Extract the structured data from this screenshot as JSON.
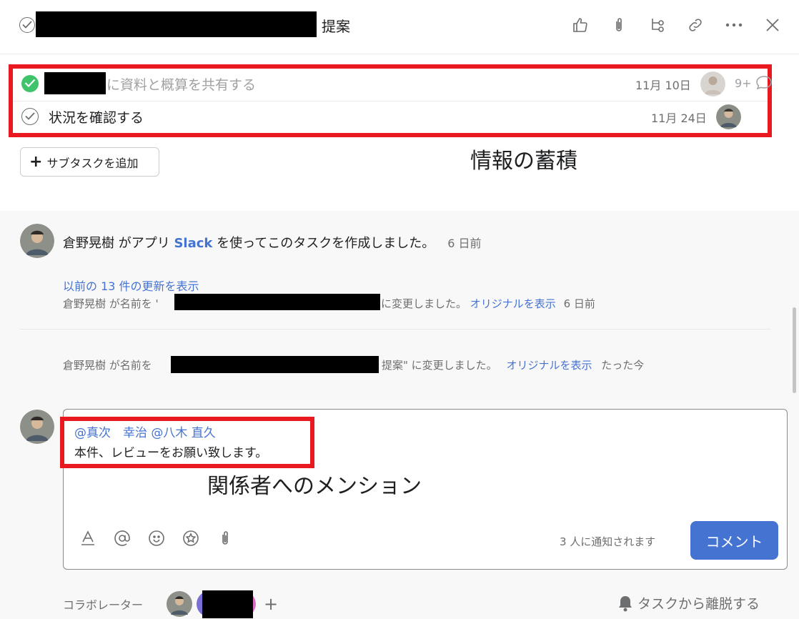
{
  "header": {
    "title_suffix": "提案",
    "icons": [
      "like-icon",
      "attachment-icon",
      "subtask-icon",
      "link-icon",
      "more-icon",
      "close-icon"
    ]
  },
  "subtasks": [
    {
      "name": "に資料と概算を共有する",
      "date": "11月 10日",
      "completed": true,
      "comment_count": "9+"
    },
    {
      "name": "状況を確認する",
      "date": "11月 24日",
      "completed": false
    }
  ],
  "add_subtask": {
    "label": "サブタスクを追加"
  },
  "annotations": {
    "subtasks": "情報の蓄積",
    "mention": "関係者へのメンション"
  },
  "activity": {
    "main_story": {
      "actor": "倉野晃樹",
      "text_before": " がアプリ ",
      "app": "Slack",
      "text_after": " を使ってこのタスクを作成しました。",
      "time": "6 日前"
    },
    "show_previous": "以前の 13 件の更新を表示",
    "story1": {
      "prefix": "倉野晃樹 が名前を '",
      "suffix": "に変更しました。",
      "link": "オリジナルを表示",
      "time": "6 日前"
    },
    "story2": {
      "prefix": "倉野晃樹 が名前を",
      "suffix": " 提案\" に変更しました。",
      "link": "オリジナルを表示",
      "time": "たった今"
    }
  },
  "composer": {
    "mentions": "@真次　幸治 @八木 直久",
    "text": "本件、レビューをお願い致します。",
    "notify": "3 人に通知されます",
    "submit_label": "コメント"
  },
  "footer": {
    "collaborators_label": "コラボレーター",
    "add": "+",
    "leave_label": "タスクから離脱する"
  },
  "colors": {
    "accent": "#4573d2",
    "annotation_red": "#e8191f",
    "done_green": "#3fc46b"
  }
}
